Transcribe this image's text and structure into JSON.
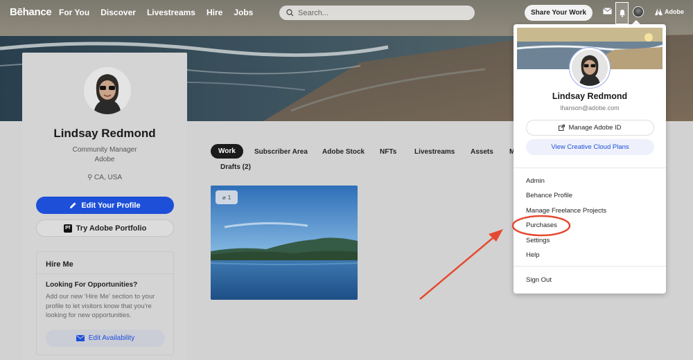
{
  "nav": {
    "logo": "Bēhance",
    "links": [
      "For You",
      "Discover",
      "Livestreams",
      "Hire",
      "Jobs"
    ],
    "search_placeholder": "Search...",
    "share_label": "Share Your Work",
    "adobe_label": "Adobe"
  },
  "profile": {
    "name": "Lindsay Redmond",
    "role": "Community Manager",
    "company": "Adobe",
    "location": "CA, USA",
    "edit_label": "Edit Your Profile",
    "portfolio_label": "Try Adobe Portfolio",
    "portfolio_badge": "Pf"
  },
  "hire": {
    "title": "Hire Me",
    "subtitle": "Looking For Opportunities?",
    "text": "Add our new 'Hire Me' section to your profile to let visitors know that you're looking for new opportunities.",
    "button_label": "Edit Availability"
  },
  "tabs": [
    "Work",
    "Subscriber Area",
    "Adobe Stock",
    "NFTs",
    "Livestreams",
    "Assets",
    "M",
    "Drafts (2)"
  ],
  "project": {
    "attachment_count": "1"
  },
  "dropdown": {
    "name": "Lindsay Redmond",
    "email": "lhanson@adobe.com",
    "manage_label": "Manage Adobe ID",
    "plans_label": "View Creative Cloud Plans",
    "items": [
      "Admin",
      "Behance Profile",
      "Manage Freelance Projects",
      "Purchases",
      "Settings",
      "Help"
    ],
    "sign_out": "Sign Out"
  },
  "colors": {
    "accent_blue": "#1d4fd8",
    "annotation_red": "#e5492f"
  }
}
